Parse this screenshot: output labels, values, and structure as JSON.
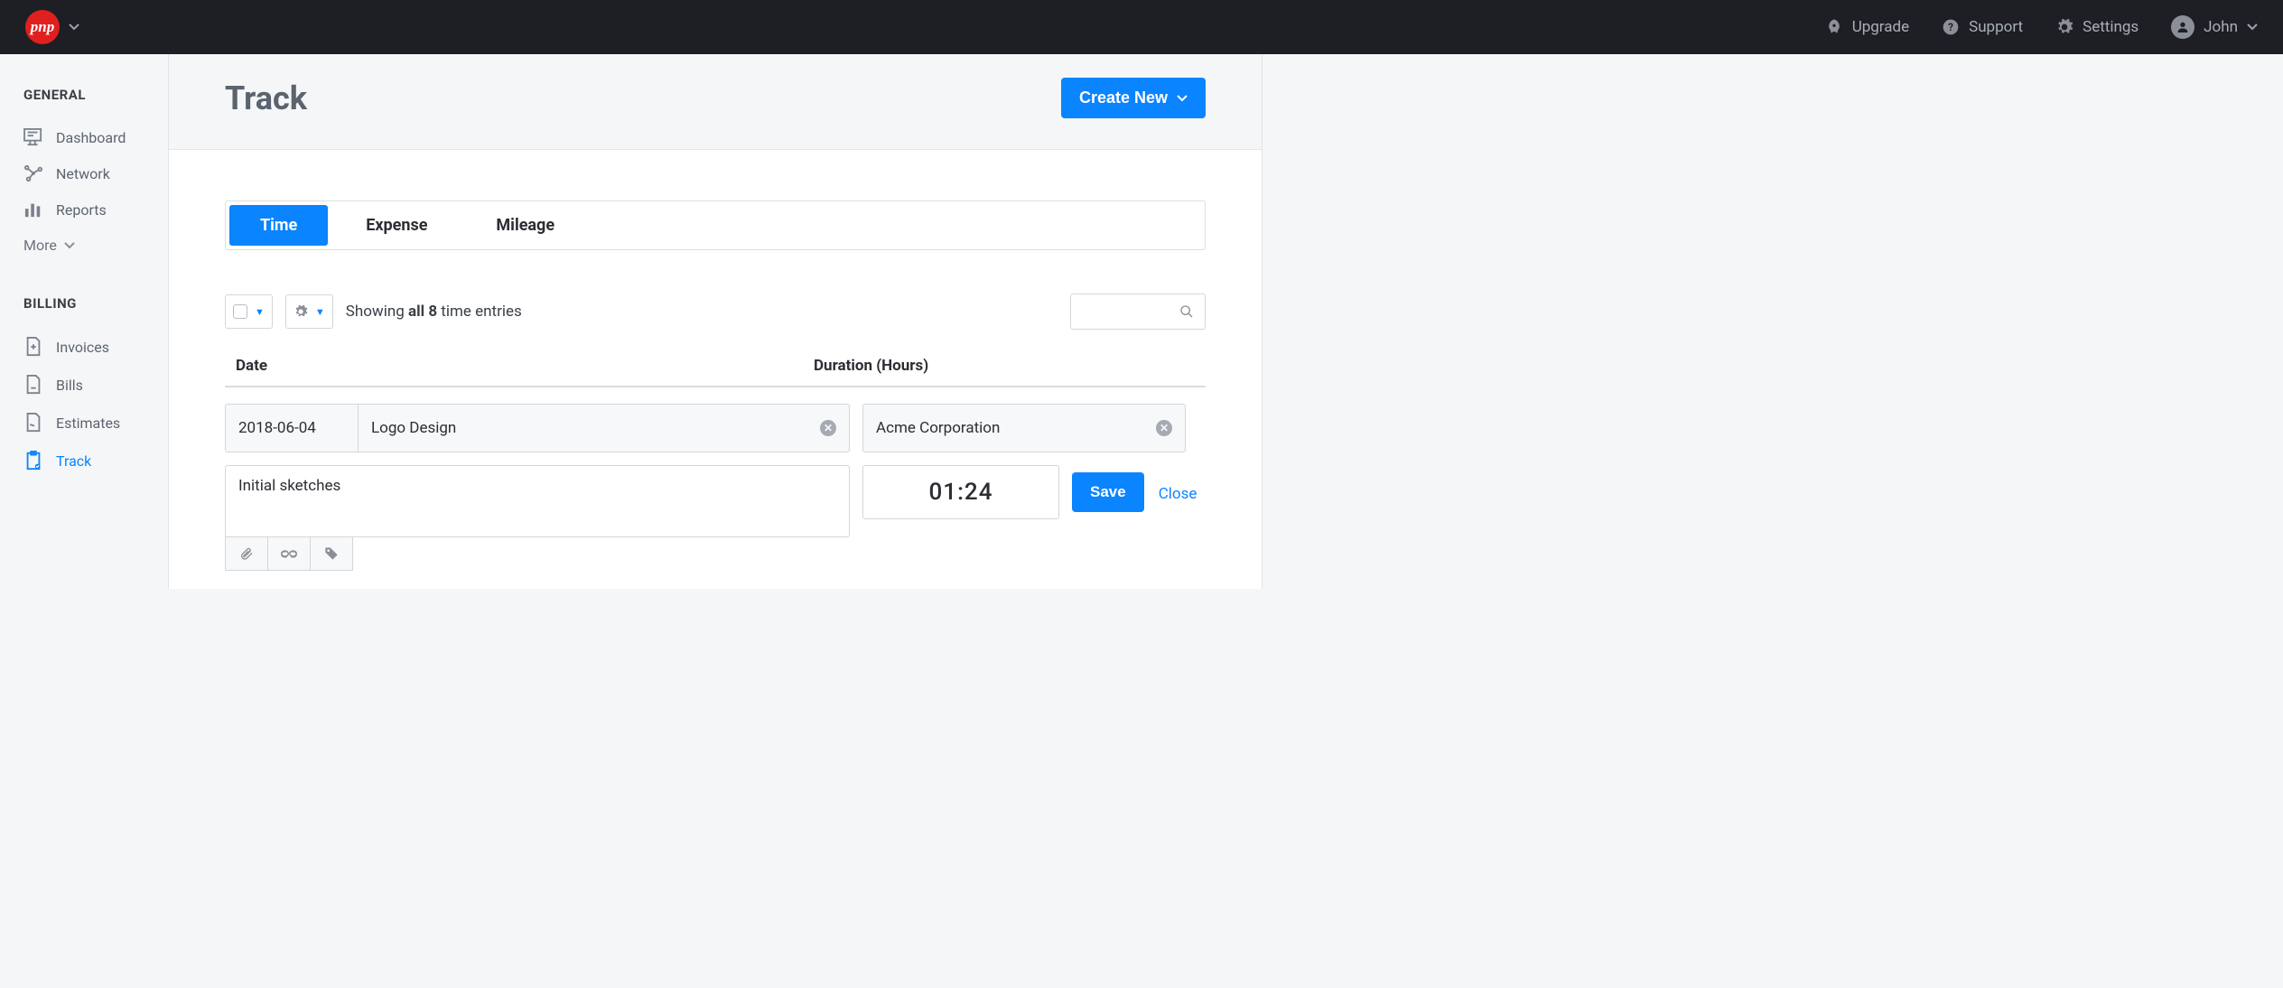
{
  "topbar": {
    "logo_text": "pnp",
    "upgrade": "Upgrade",
    "support": "Support",
    "settings": "Settings",
    "user_name": "John"
  },
  "sidebar": {
    "heading_general": "GENERAL",
    "heading_billing": "BILLING",
    "general": {
      "dashboard": "Dashboard",
      "network": "Network",
      "reports": "Reports",
      "more": "More"
    },
    "billing": {
      "invoices": "Invoices",
      "bills": "Bills",
      "estimates": "Estimates",
      "track": "Track"
    }
  },
  "page": {
    "title": "Track",
    "create_new": "Create New"
  },
  "tabs": {
    "time": "Time",
    "expense": "Expense",
    "mileage": "Mileage"
  },
  "toolbar": {
    "showing_prefix": "Showing ",
    "showing_bold": "all 8",
    "showing_suffix": " time entries"
  },
  "table": {
    "col_date": "Date",
    "col_duration": "Duration (Hours)"
  },
  "entry": {
    "date": "2018-06-04",
    "project": "Logo Design",
    "client": "Acme Corporation",
    "description": "Initial sketches",
    "duration": "01:24",
    "save": "Save",
    "close": "Close"
  }
}
